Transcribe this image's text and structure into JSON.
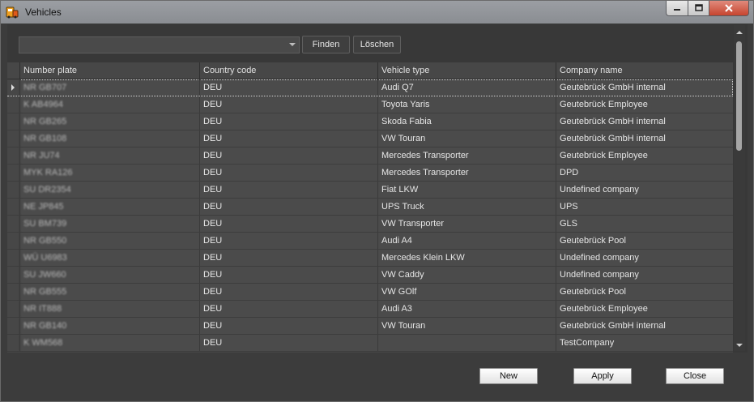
{
  "window": {
    "title": "Vehicles",
    "icon": "vehicle-app-icon",
    "controls": {
      "minimize_icon": "minimize-icon",
      "maximize_icon": "maximize-icon",
      "close_icon": "close-icon"
    }
  },
  "toolbar": {
    "search_value": "",
    "find_label": "Finden",
    "clear_label": "Löschen"
  },
  "table": {
    "columns": [
      "Number plate",
      "Country code",
      "Vehicle type",
      "Company name"
    ],
    "rows": [
      {
        "plate": "NR GB707",
        "country": "DEU",
        "type": "Audi Q7",
        "company": "Geutebrück GmbH internal"
      },
      {
        "plate": "K AB4964",
        "country": "DEU",
        "type": "Toyota Yaris",
        "company": "Geutebrück Employee"
      },
      {
        "plate": "NR GB265",
        "country": "DEU",
        "type": "Skoda Fabia",
        "company": "Geutebrück GmbH internal"
      },
      {
        "plate": "NR GB108",
        "country": "DEU",
        "type": "VW Touran",
        "company": "Geutebrück GmbH internal"
      },
      {
        "plate": "NR JU74",
        "country": "DEU",
        "type": "Mercedes Transporter",
        "company": "Geutebrück Employee"
      },
      {
        "plate": "MYK RA126",
        "country": "DEU",
        "type": "Mercedes Transporter",
        "company": "DPD"
      },
      {
        "plate": "SU DR2354",
        "country": "DEU",
        "type": "Fiat LKW",
        "company": "Undefined company"
      },
      {
        "plate": "NE JP845",
        "country": "DEU",
        "type": "UPS Truck",
        "company": "UPS"
      },
      {
        "plate": "SU BM739",
        "country": "DEU",
        "type": "VW Transporter",
        "company": "GLS"
      },
      {
        "plate": "NR GB550",
        "country": "DEU",
        "type": "Audi A4",
        "company": "Geutebrück Pool"
      },
      {
        "plate": "WÜ U6983",
        "country": "DEU",
        "type": "Mercedes Klein LKW",
        "company": "Undefined company"
      },
      {
        "plate": "SU JW660",
        "country": "DEU",
        "type": "VW Caddy",
        "company": "Undefined company"
      },
      {
        "plate": "NR GB555",
        "country": "DEU",
        "type": "VW GOlf",
        "company": "Geutebrück Pool"
      },
      {
        "plate": "NR IT888",
        "country": "DEU",
        "type": "Audi A3",
        "company": "Geutebrück Employee"
      },
      {
        "plate": "NR GB140",
        "country": "DEU",
        "type": "VW Touran",
        "company": "Geutebrück GmbH internal"
      },
      {
        "plate": "K WM568",
        "country": "DEU",
        "type": "",
        "company": "TestCompany"
      }
    ],
    "current_row_index": 0
  },
  "footer": {
    "new_label": "New",
    "apply_label": "Apply",
    "close_label": "Close"
  }
}
